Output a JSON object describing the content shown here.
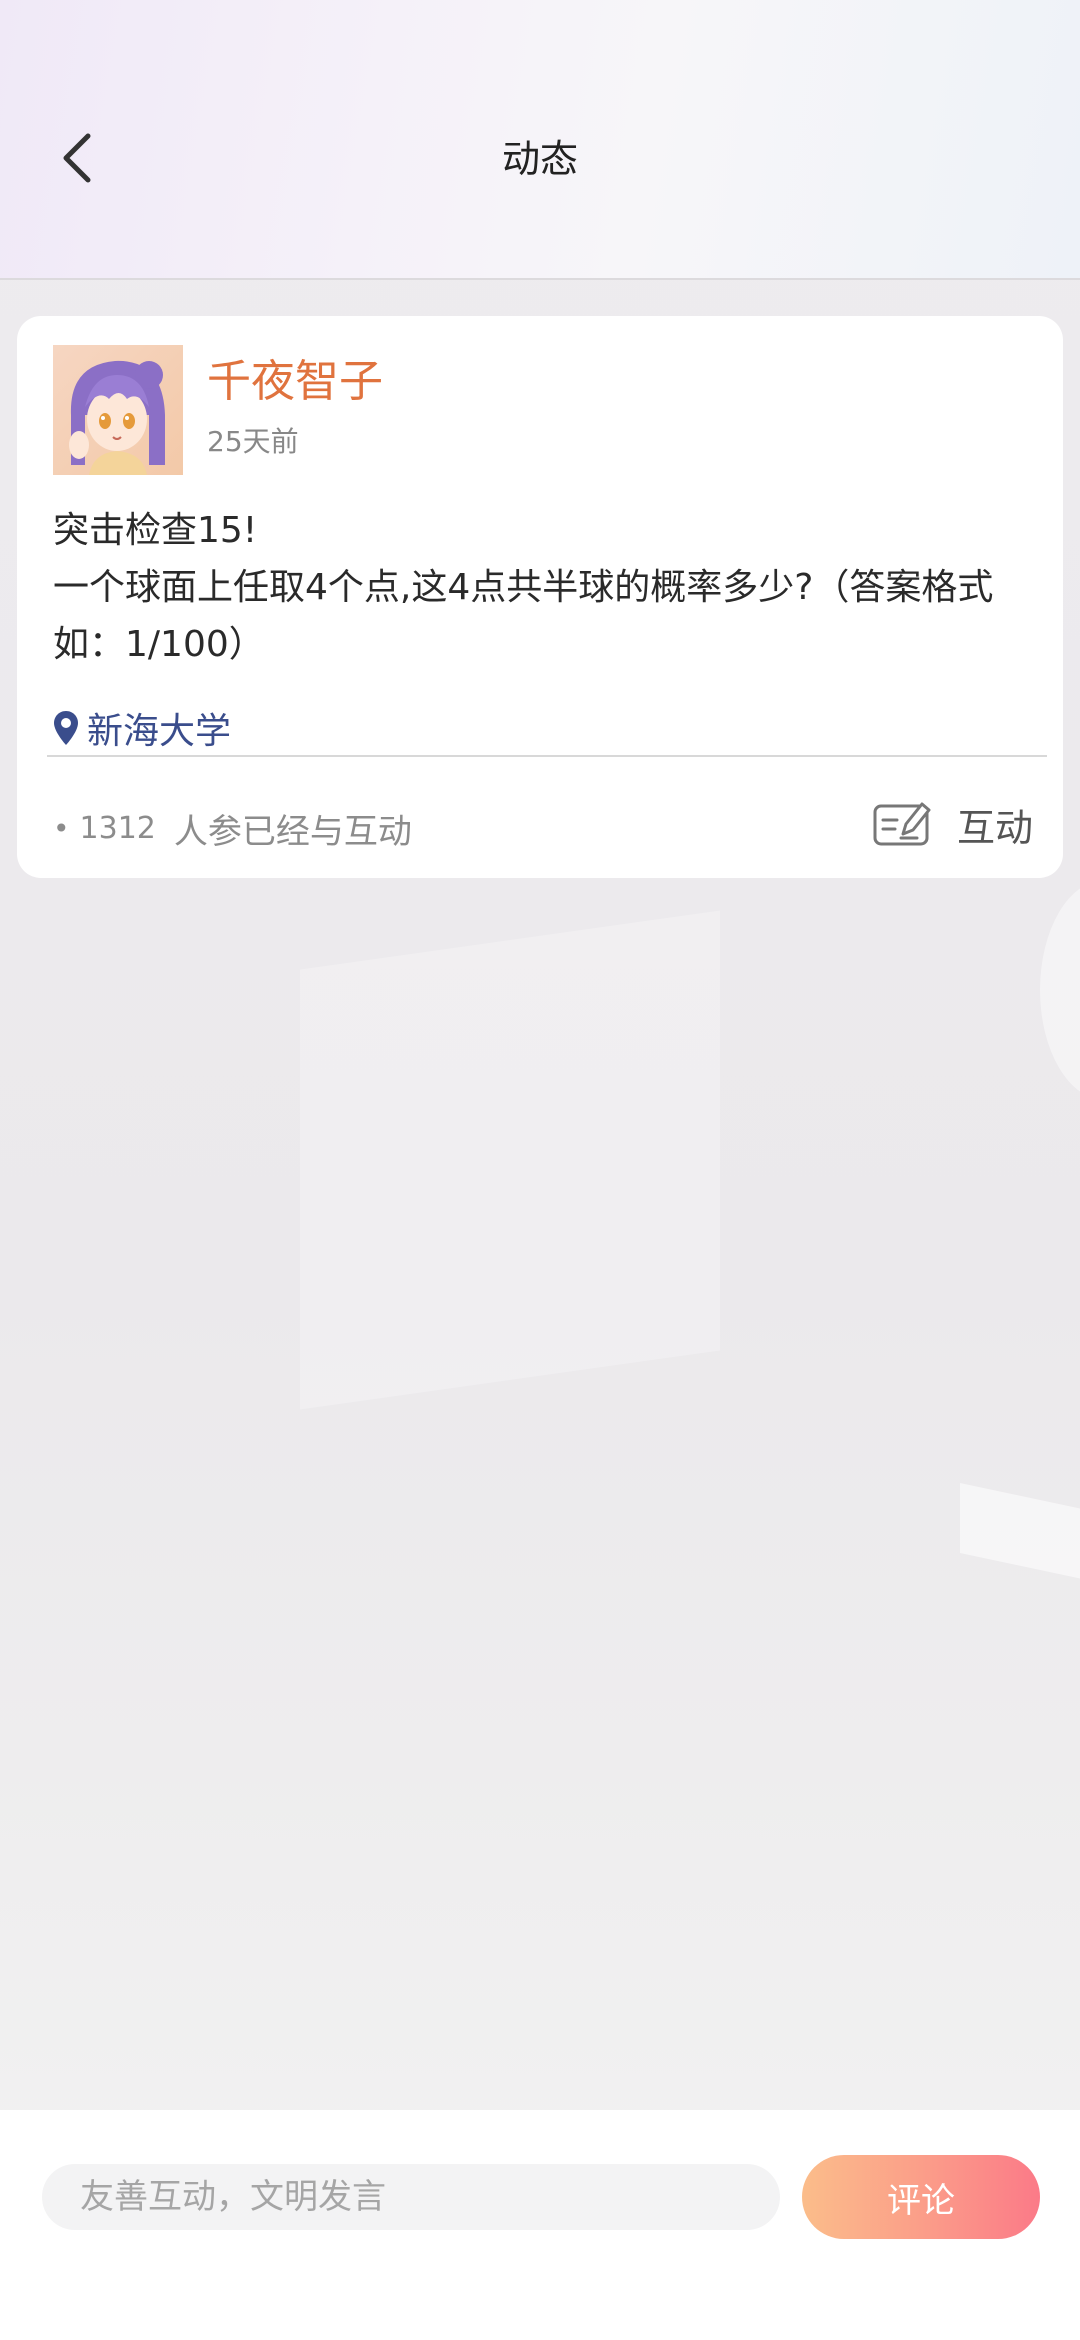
{
  "header": {
    "title": "动态"
  },
  "post": {
    "username": "千夜智子",
    "time": "25天前",
    "content": "突击检查15!\n一个球面上任取4个点,这4点共半球的概率多少?（答案格式如：1/100）",
    "location": "新海大学",
    "participants_count": "1312",
    "participants_suffix": "人参已经与互动",
    "interact_label": "互动"
  },
  "bottom_bar": {
    "input_placeholder": "友善互动，文明发言",
    "comment_button": "评论"
  },
  "colors": {
    "username": "#e0733e",
    "location": "#3a4d8c",
    "comment_gradient_start": "#fbbd8a",
    "comment_gradient_end": "#fb7a88"
  },
  "icons": {
    "back": "chevron-left-icon",
    "location": "map-pin-icon",
    "interact": "edit-card-icon"
  }
}
